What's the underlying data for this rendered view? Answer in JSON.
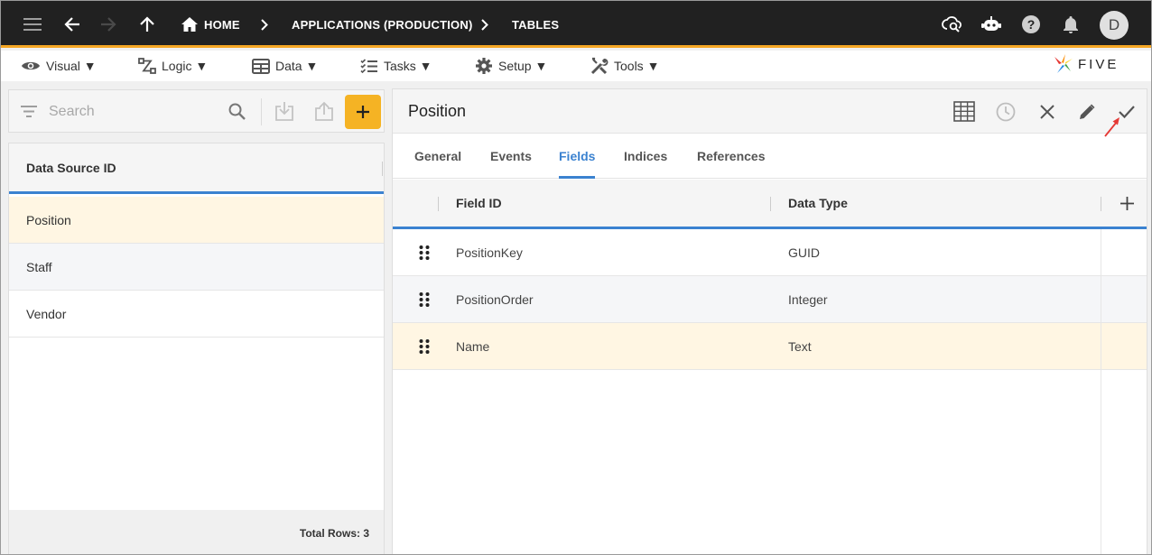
{
  "topbar": {
    "breadcrumb": [
      "HOME",
      "APPLICATIONS (PRODUCTION)",
      "TABLES"
    ],
    "avatar_initial": "D",
    "icons": [
      "menu-icon",
      "back-arrow-icon",
      "forward-arrow-icon",
      "up-arrow-icon",
      "home-icon",
      "cloud-search-icon",
      "chatbot-icon",
      "help-icon",
      "bell-icon"
    ]
  },
  "menubar": {
    "items": [
      {
        "label": "Visual ▼",
        "icon": "eye-icon"
      },
      {
        "label": "Logic ▼",
        "icon": "flow-icon"
      },
      {
        "label": "Data ▼",
        "icon": "table-icon"
      },
      {
        "label": "Tasks ▼",
        "icon": "checklist-icon"
      },
      {
        "label": "Setup ▼",
        "icon": "gear-icon"
      },
      {
        "label": "Tools ▼",
        "icon": "tools-icon"
      }
    ],
    "logo_text": "FIVE"
  },
  "left": {
    "search_placeholder": "Search",
    "column_header": "Data Source ID",
    "rows": [
      "Position",
      "Staff",
      "Vendor"
    ],
    "selected_row": "Position",
    "footer": "Total Rows: 3"
  },
  "right": {
    "title": "Position",
    "tabs": [
      "General",
      "Events",
      "Fields",
      "Indices",
      "References"
    ],
    "active_tab": "Fields",
    "columns": [
      "Field ID",
      "Data Type"
    ],
    "rows": [
      {
        "field_id": "PositionKey",
        "data_type": "GUID"
      },
      {
        "field_id": "PositionOrder",
        "data_type": "Integer"
      },
      {
        "field_id": "Name",
        "data_type": "Text"
      }
    ],
    "selected_row": "Name"
  },
  "colors": {
    "topbar_bg": "#212121",
    "accent_orange": "#f5a623",
    "accent_blue": "#3b82d0",
    "selected_row_bg": "#fff6e3",
    "add_button": "#f5b324"
  }
}
